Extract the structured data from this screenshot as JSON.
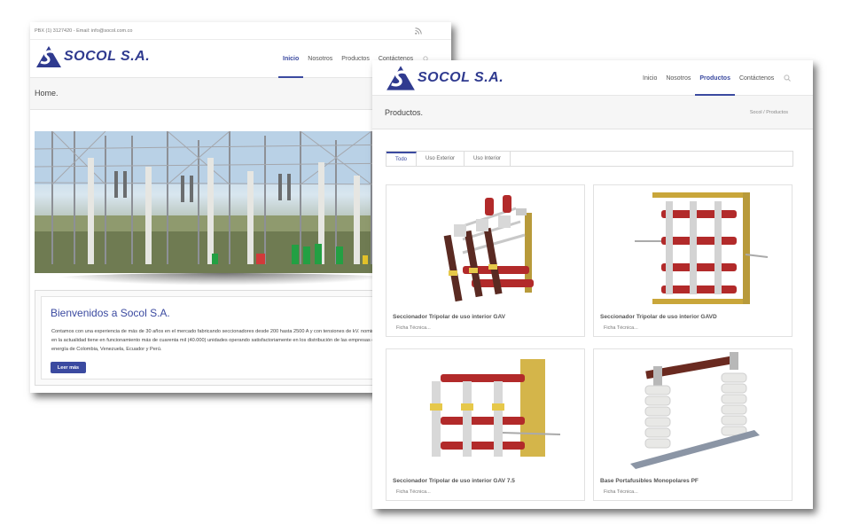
{
  "home": {
    "topbar": {
      "contact": "PBX (1) 3127420 - Email: info@socol.com.co",
      "rss_icon": "rss-icon"
    },
    "logo_text": "SOCOL S.A.",
    "nav": [
      "Inicio",
      "Nosotros",
      "Productos",
      "Contáctenos"
    ],
    "active_nav": "Inicio",
    "page_title": "Home.",
    "welcome": {
      "heading": "Bienvenidos a Socol S.A.",
      "body": "Contamos con una experiencia de más de 30 años en el mercado fabricando seccionadores desde 200 hasta 2500 A y con tensiones de kV. nominales y en la actualidad tiene en funcionamiento más de cuarenta mil (40.000) unidades operando satisfactoriamente en los distribución de las empresas de energía de Colombia, Venezuela, Ecuador y Perú.",
      "button": "Leer más"
    }
  },
  "products": {
    "logo_text": "SOCOL S.A.",
    "nav": [
      "Inicio",
      "Nosotros",
      "Productos",
      "Contáctenos"
    ],
    "active_nav": "Productos",
    "page_title": "Productos.",
    "breadcrumb": "Socol / Productos",
    "tabs": [
      "Todo",
      "Uso Exterior",
      "Uso Interior"
    ],
    "active_tab": "Todo",
    "items": [
      {
        "title": "Seccionador Tripolar de uso interior GAV",
        "link": "Ficha Técnica..."
      },
      {
        "title": "Seccionador Tripolar de uso interior GAVD",
        "link": "Ficha Técnica..."
      },
      {
        "title": "Seccionador Tripolar de uso interior GAV 7.5",
        "link": "Ficha Técnica..."
      },
      {
        "title": "Base Portafusibles Monopolares PF",
        "link": "Ficha Técnica..."
      }
    ]
  },
  "colors": {
    "brand": "#3b4aa0",
    "logo": "#2f3a8f",
    "insulator_red": "#b22a2a"
  }
}
